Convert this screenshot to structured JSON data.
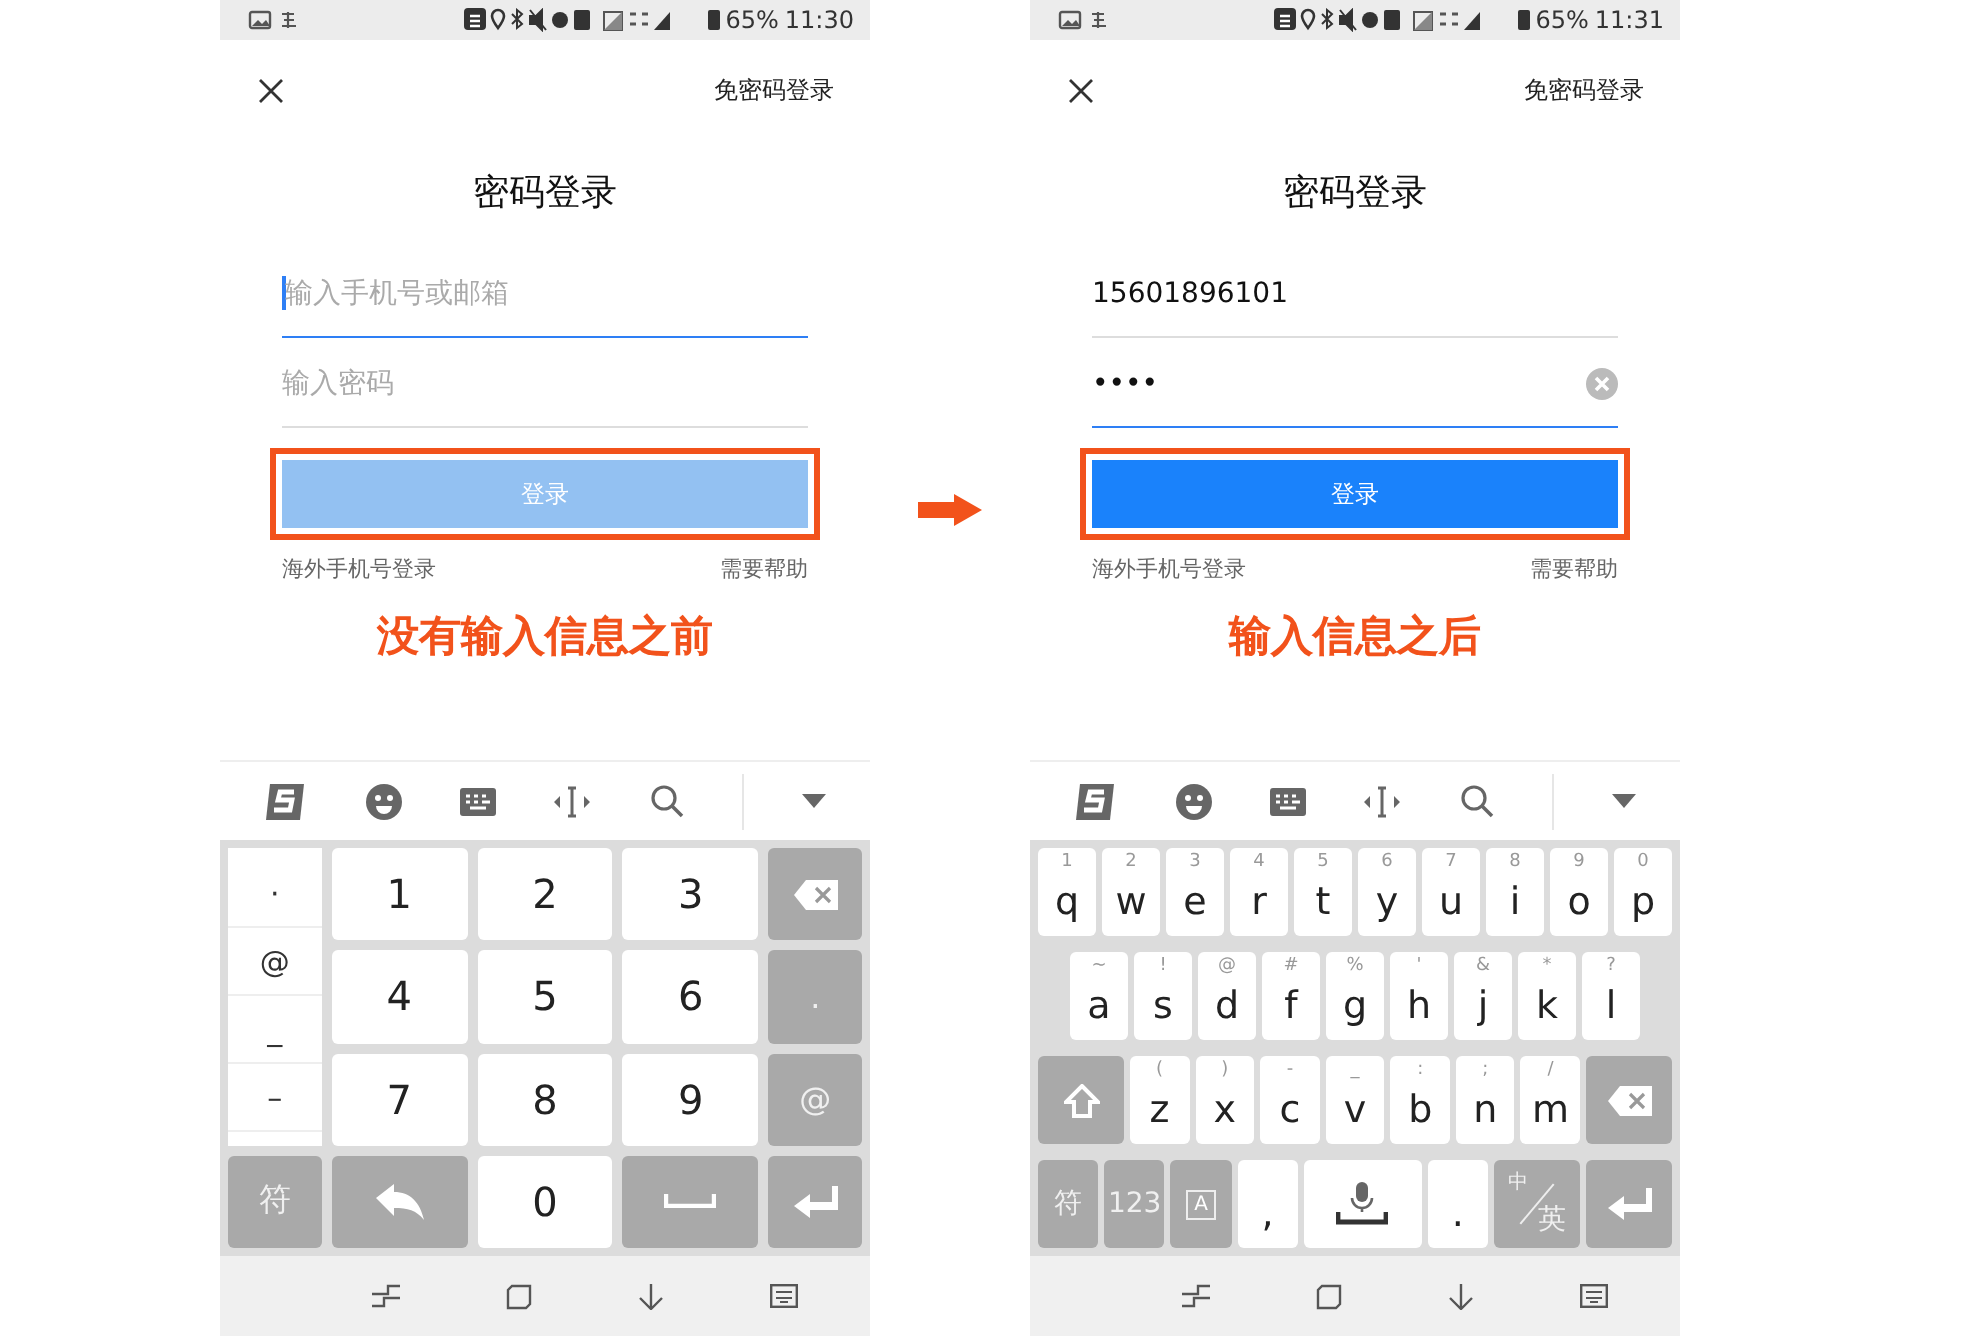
{
  "phones": [
    {
      "status_bar": {
        "battery": "65%",
        "time": "11:30"
      },
      "header_link": "免密码登录",
      "title": "密码登录",
      "fields": [
        {
          "placeholder": "输入手机号或邮箱",
          "focused": true,
          "clearable": false
        },
        {
          "placeholder": "输入密码",
          "focused": false,
          "clearable": false
        }
      ],
      "login_button": {
        "label": "登录",
        "enabled": false,
        "highlighted": true
      },
      "links": [
        "海外手机号登录",
        "需要帮助"
      ],
      "caption": "没有输入信息之前",
      "keyboard": {
        "kind": "numeric",
        "symbols": [
          "·",
          "@",
          "_",
          "–"
        ],
        "key_rows": [
          [
            {
              "kind": "char",
              "label": "1",
              "dark": false
            },
            {
              "kind": "char",
              "label": "2",
              "dark": false
            },
            {
              "kind": "char",
              "label": "3",
              "dark": false
            },
            {
              "kind": "backspace",
              "dark": true
            }
          ],
          [
            {
              "kind": "char",
              "label": "4",
              "dark": false
            },
            {
              "kind": "char",
              "label": "5",
              "dark": false
            },
            {
              "kind": "char",
              "label": "6",
              "dark": false
            },
            {
              "kind": "char",
              "label": ".",
              "dark": true
            }
          ],
          [
            {
              "kind": "char",
              "label": "7",
              "dark": false
            },
            {
              "kind": "char",
              "label": "8",
              "dark": false
            },
            {
              "kind": "char",
              "label": "9",
              "dark": false
            },
            {
              "kind": "char",
              "label": "@",
              "dark": true
            }
          ],
          [
            {
              "kind": "char",
              "label": "符",
              "dark": true
            },
            {
              "kind": "undo",
              "dark": true
            },
            {
              "kind": "char",
              "label": "0",
              "dark": false
            },
            {
              "kind": "space",
              "dark": true
            },
            {
              "kind": "enter",
              "dark": true
            }
          ]
        ]
      }
    },
    {
      "status_bar": {
        "battery": "65%",
        "time": "11:31"
      },
      "header_link": "免密码登录",
      "title": "密码登录",
      "fields": [
        {
          "value": "15601896101",
          "focused": false,
          "clearable": false
        },
        {
          "value": "••••",
          "focused": true,
          "clearable": true
        }
      ],
      "login_button": {
        "label": "登录",
        "enabled": true,
        "highlighted": true
      },
      "links": [
        "海外手机号登录",
        "需要帮助"
      ],
      "caption": "输入信息之后",
      "keyboard": {
        "kind": "qwerty",
        "key_rows": [
          [
            {
              "kind": "char",
              "hint": "1",
              "label": "q",
              "dark": false
            },
            {
              "kind": "char",
              "hint": "2",
              "label": "w",
              "dark": false
            },
            {
              "kind": "char",
              "hint": "3",
              "label": "e",
              "dark": false
            },
            {
              "kind": "char",
              "hint": "4",
              "label": "r",
              "dark": false
            },
            {
              "kind": "char",
              "hint": "5",
              "label": "t",
              "dark": false
            },
            {
              "kind": "char",
              "hint": "6",
              "label": "y",
              "dark": false
            },
            {
              "kind": "char",
              "hint": "7",
              "label": "u",
              "dark": false
            },
            {
              "kind": "char",
              "hint": "8",
              "label": "i",
              "dark": false
            },
            {
              "kind": "char",
              "hint": "9",
              "label": "o",
              "dark": false
            },
            {
              "kind": "char",
              "hint": "0",
              "label": "p",
              "dark": false
            }
          ],
          [
            {
              "kind": "char",
              "hint": "~",
              "label": "a",
              "dark": false
            },
            {
              "kind": "char",
              "hint": "!",
              "label": "s",
              "dark": false
            },
            {
              "kind": "char",
              "hint": "@",
              "label": "d",
              "dark": false
            },
            {
              "kind": "char",
              "hint": "#",
              "label": "f",
              "dark": false
            },
            {
              "kind": "char",
              "hint": "%",
              "label": "g",
              "dark": false
            },
            {
              "kind": "char",
              "hint": "'",
              "label": "h",
              "dark": false
            },
            {
              "kind": "char",
              "hint": "&",
              "label": "j",
              "dark": false
            },
            {
              "kind": "char",
              "hint": "*",
              "label": "k",
              "dark": false
            },
            {
              "kind": "char",
              "hint": "?",
              "label": "l",
              "dark": false
            }
          ],
          [
            {
              "kind": "shift",
              "dark": true
            },
            {
              "kind": "char",
              "hint": "(",
              "label": "z",
              "dark": false
            },
            {
              "kind": "char",
              "hint": ")",
              "label": "x",
              "dark": false
            },
            {
              "kind": "char",
              "hint": "-",
              "label": "c",
              "dark": false
            },
            {
              "kind": "char",
              "hint": "_",
              "label": "v",
              "dark": false
            },
            {
              "kind": "char",
              "hint": ":",
              "label": "b",
              "dark": false
            },
            {
              "kind": "char",
              "hint": ";",
              "label": "n",
              "dark": false
            },
            {
              "kind": "char",
              "hint": "/",
              "label": "m",
              "dark": false
            },
            {
              "kind": "backspace",
              "dark": true
            }
          ],
          [
            {
              "kind": "char",
              "label": "符",
              "dark": true
            },
            {
              "kind": "char",
              "label": "123",
              "dark": true
            },
            {
              "kind": "boxed",
              "label": "A",
              "dark": true
            },
            {
              "kind": "char",
              "label": ",",
              "dark": false
            },
            {
              "kind": "voice-space",
              "dark": false
            },
            {
              "kind": "char",
              "label": ".",
              "dark": false
            },
            {
              "kind": "lang",
              "hint": "中",
              "label": "英",
              "dark": true
            },
            {
              "kind": "enter",
              "dark": true
            }
          ]
        ]
      }
    }
  ]
}
